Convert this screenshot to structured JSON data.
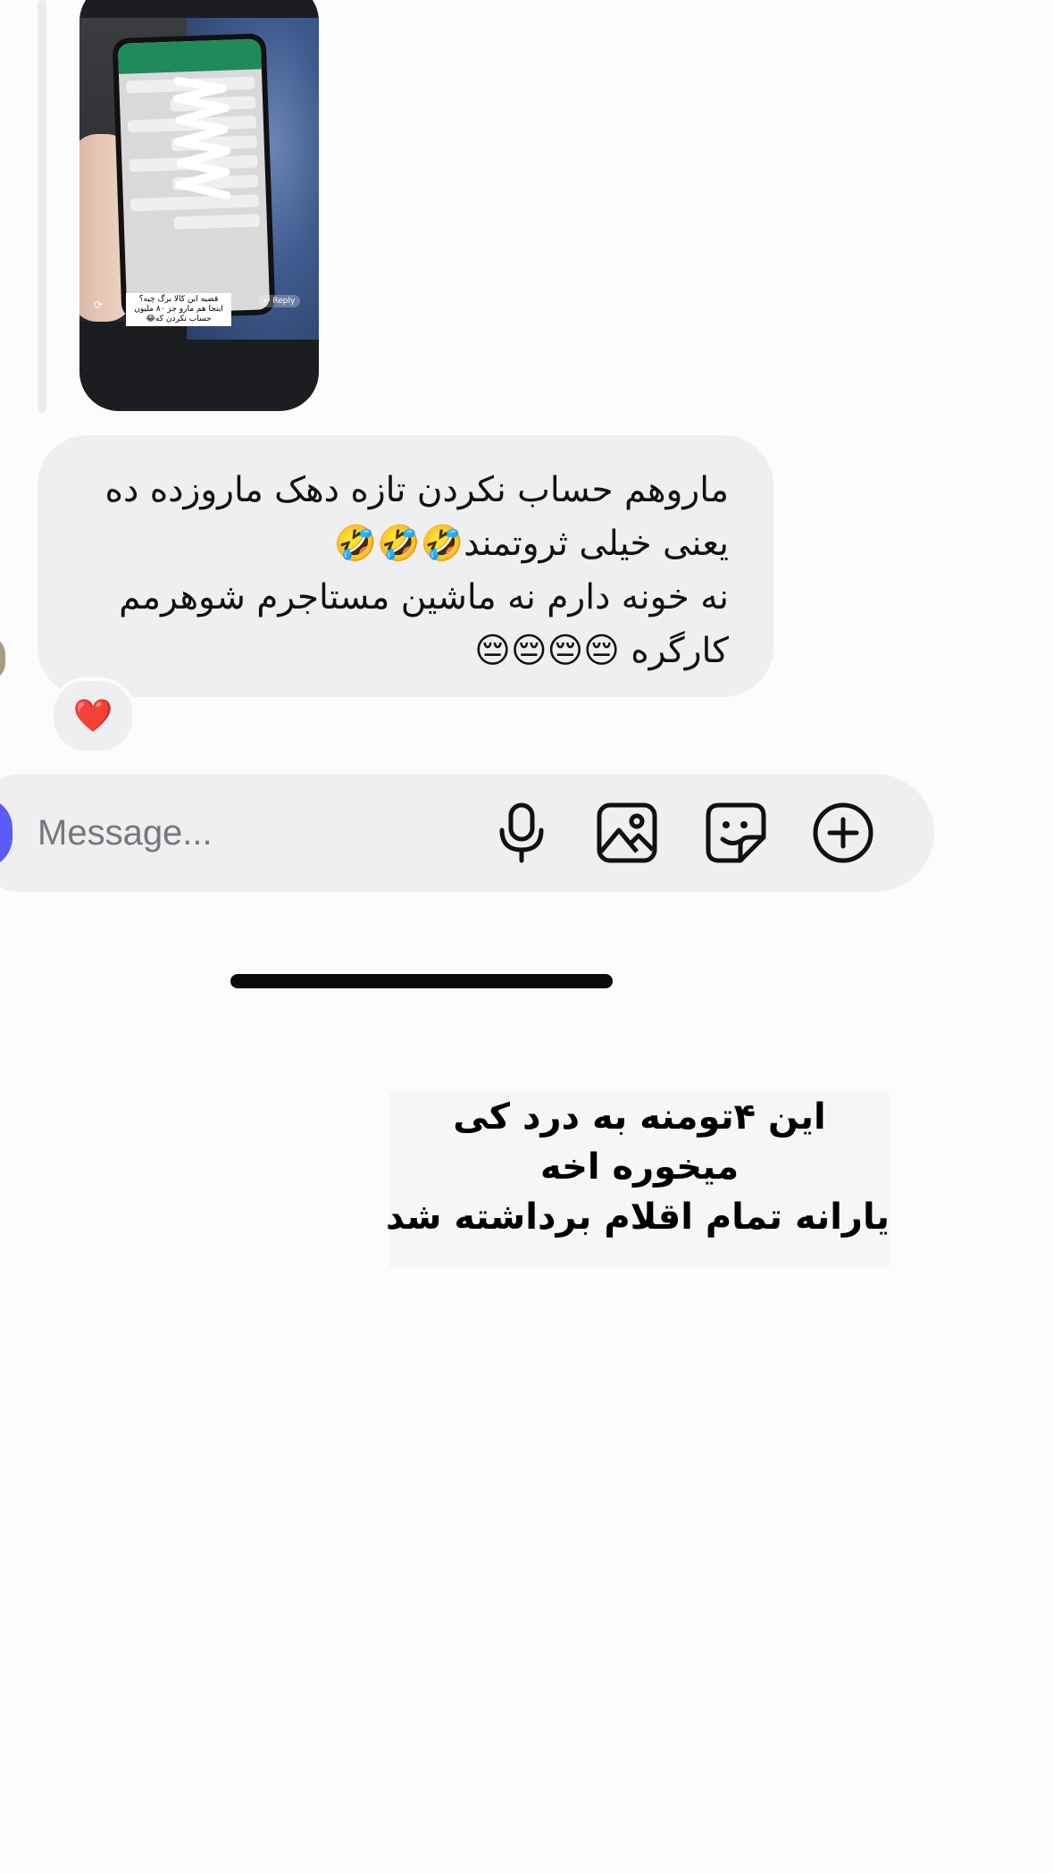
{
  "shared_post": {
    "caption_lines": [
      "قضیه این کالا برگ چیه؟",
      "اینجا هم مارو جز ۸۰ ملیون",
      "حساب نکردن که😂"
    ],
    "reply_label": "↩ Reply"
  },
  "message": {
    "lines": [
      "ماروهم حساب نکردن تازه دهک ماروزده ده",
      "یعنی خیلی ثروتمند🤣🤣🤣",
      "نه خونه دارم نه ماشین مستاجرم شوهرمم",
      "کارگره 😔😔😔😔"
    ],
    "reaction": "❤️"
  },
  "composer": {
    "placeholder": "Message...",
    "icons": [
      "microphone-icon",
      "image-icon",
      "sticker-icon",
      "plus-circle-icon"
    ]
  },
  "overlay_text": {
    "lines": [
      "این ۴تومنه به درد کی",
      "میخوره اخه",
      "یارانه تمام اقلام برداشته شد"
    ]
  },
  "colors": {
    "bubble": "#efeff1",
    "accent": "#5b5cf7",
    "background": "#fcfcfc"
  }
}
